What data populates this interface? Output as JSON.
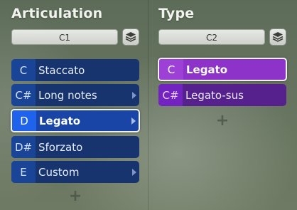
{
  "left": {
    "title": "Articulation",
    "cc": "C1",
    "items": [
      {
        "key": "C",
        "label": "Staccato",
        "submenu": false,
        "selected": false
      },
      {
        "key": "C#",
        "label": "Long notes",
        "submenu": true,
        "selected": false
      },
      {
        "key": "D",
        "label": "Legato",
        "submenu": true,
        "selected": true
      },
      {
        "key": "D#",
        "label": "Sforzato",
        "submenu": false,
        "selected": false
      },
      {
        "key": "E",
        "label": "Custom",
        "submenu": true,
        "selected": false
      }
    ],
    "add_label": "+"
  },
  "right": {
    "title": "Type",
    "cc": "C2",
    "items": [
      {
        "key": "C",
        "label": "Legato",
        "submenu": false,
        "selected": true
      },
      {
        "key": "C#",
        "label": "Legato-sus",
        "submenu": false,
        "selected": false
      }
    ],
    "add_label": "+"
  },
  "colors": {
    "blue_item": "#17346e",
    "blue_selected": "#1945a6",
    "purple_item": "#56208d",
    "purple_selected": "#8e33c9"
  },
  "icons": {
    "layer": "layers-icon",
    "submenu": "chevron-right-icon"
  }
}
